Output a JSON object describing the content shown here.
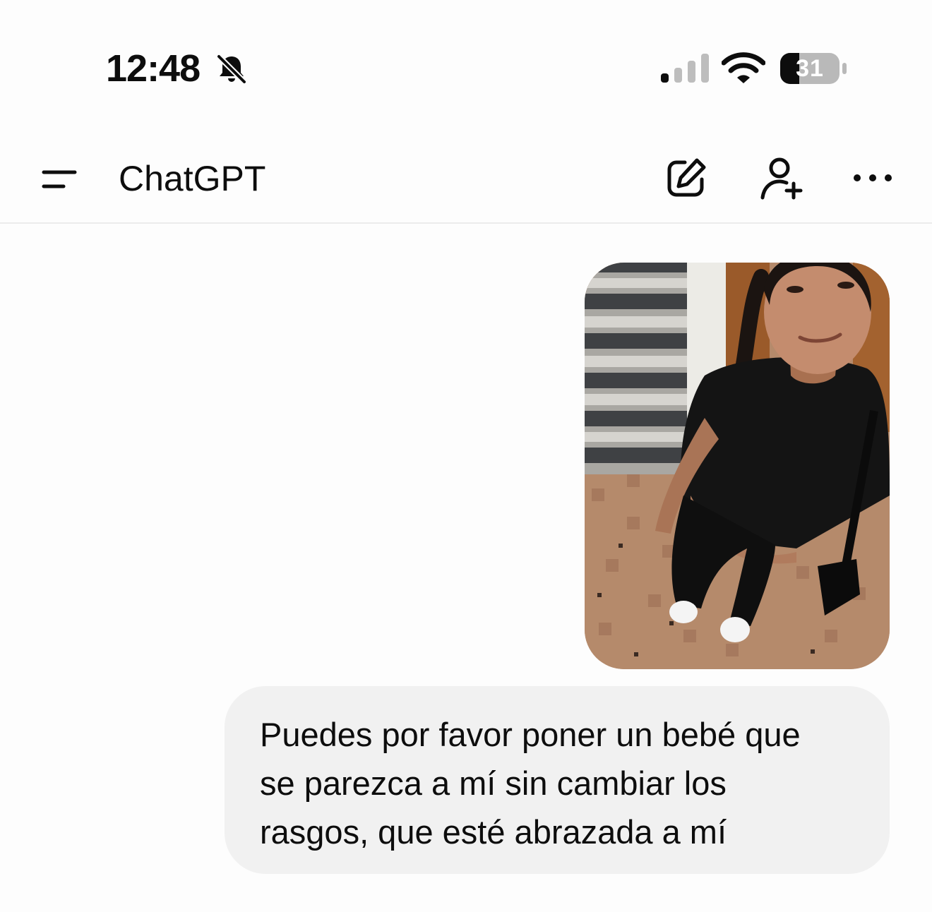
{
  "status_bar": {
    "time": "12:48",
    "battery_level": "31",
    "signal_bars_active": 1,
    "signal_bars_total": 4,
    "icons": [
      "bell-slash-icon",
      "cellular-signal-icon",
      "wifi-icon",
      "battery-icon"
    ]
  },
  "header": {
    "title": "ChatGPT",
    "icons": [
      "menu-icon",
      "new-chat-icon",
      "add-person-icon",
      "more-icon"
    ]
  },
  "conversation": {
    "user_message": {
      "attachment_kind": "photo",
      "text": "Puedes por favor poner un bebé que\nse parezca a mí sin cambiar los\nrasgos, que esté abrazada a mí"
    }
  },
  "colors": {
    "background": "#fdfdfd",
    "bubble": "#f1f1f1",
    "text": "#0d0d0d",
    "divider": "#ececec"
  }
}
